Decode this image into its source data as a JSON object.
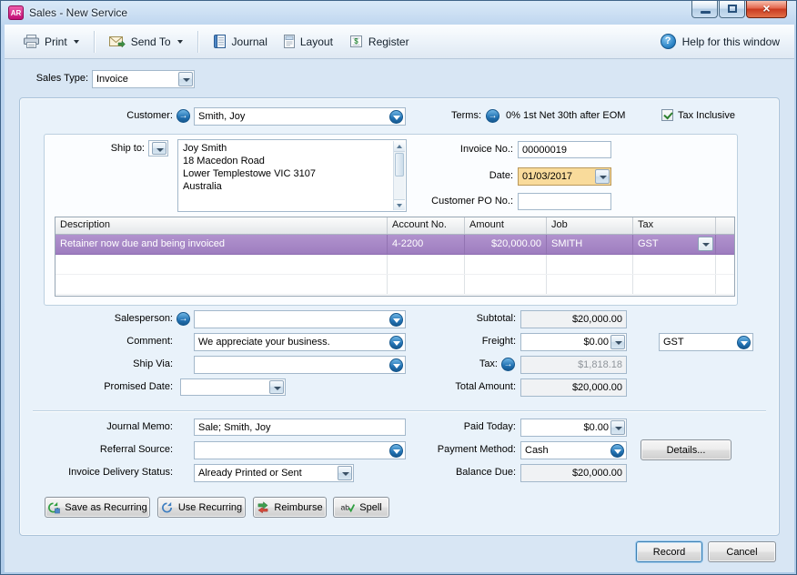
{
  "window": {
    "title": "Sales - New Service",
    "app_badge": "AR"
  },
  "toolbar": {
    "print": "Print",
    "send_to": "Send To",
    "journal": "Journal",
    "layout": "Layout",
    "register": "Register",
    "help": "Help for this window"
  },
  "sales_type": {
    "label": "Sales Type:",
    "value": "Invoice"
  },
  "header": {
    "customer_label": "Customer:",
    "customer": "Smith, Joy",
    "terms_label": "Terms:",
    "terms": "0% 1st Net 30th after EOM",
    "tax_inclusive": "Tax Inclusive"
  },
  "details": {
    "ship_to_label": "Ship to:",
    "ship_to_address": "Joy Smith\n18 Macedon Road\nLower Templestowe  VIC  3107\nAustralia",
    "invoice_no_label": "Invoice No.:",
    "invoice_no": "00000019",
    "date_label": "Date:",
    "date": "01/03/2017",
    "customer_po_label": "Customer PO No.:",
    "customer_po": ""
  },
  "line_items": {
    "headers": {
      "description": "Description",
      "account": "Account No.",
      "amount": "Amount",
      "job": "Job",
      "tax": "Tax"
    },
    "rows": [
      {
        "description": "Retainer now due and being invoiced",
        "account": "4-2200",
        "amount": "$20,000.00",
        "job": "SMITH",
        "tax": "GST"
      }
    ]
  },
  "totals": {
    "salesperson_label": "Salesperson:",
    "salesperson": "",
    "comment_label": "Comment:",
    "comment": "We appreciate your business.",
    "ship_via_label": "Ship Via:",
    "ship_via": "",
    "promised_date_label": "Promised Date:",
    "promised_date": "",
    "subtotal_label": "Subtotal:",
    "subtotal": "$20,000.00",
    "freight_label": "Freight:",
    "freight": "$0.00",
    "freight_tax_code": "GST",
    "tax_label": "Tax:",
    "tax": "$1,818.18",
    "total_label": "Total Amount:",
    "total": "$20,000.00"
  },
  "footer": {
    "journal_memo_label": "Journal Memo:",
    "journal_memo": "Sale; Smith, Joy",
    "referral_label": "Referral Source:",
    "referral": "",
    "delivery_label": "Invoice Delivery Status:",
    "delivery": "Already Printed or Sent",
    "paid_today_label": "Paid Today:",
    "paid_today": "$0.00",
    "payment_method_label": "Payment Method:",
    "payment_method": "Cash",
    "details_button": "Details...",
    "balance_due_label": "Balance Due:",
    "balance_due": "$20,000.00"
  },
  "buttons": {
    "save_recurring": "Save as Recurring",
    "use_recurring": "Use Recurring",
    "reimburse": "Reimburse",
    "spell": "Spell",
    "record": "Record",
    "cancel": "Cancel"
  }
}
